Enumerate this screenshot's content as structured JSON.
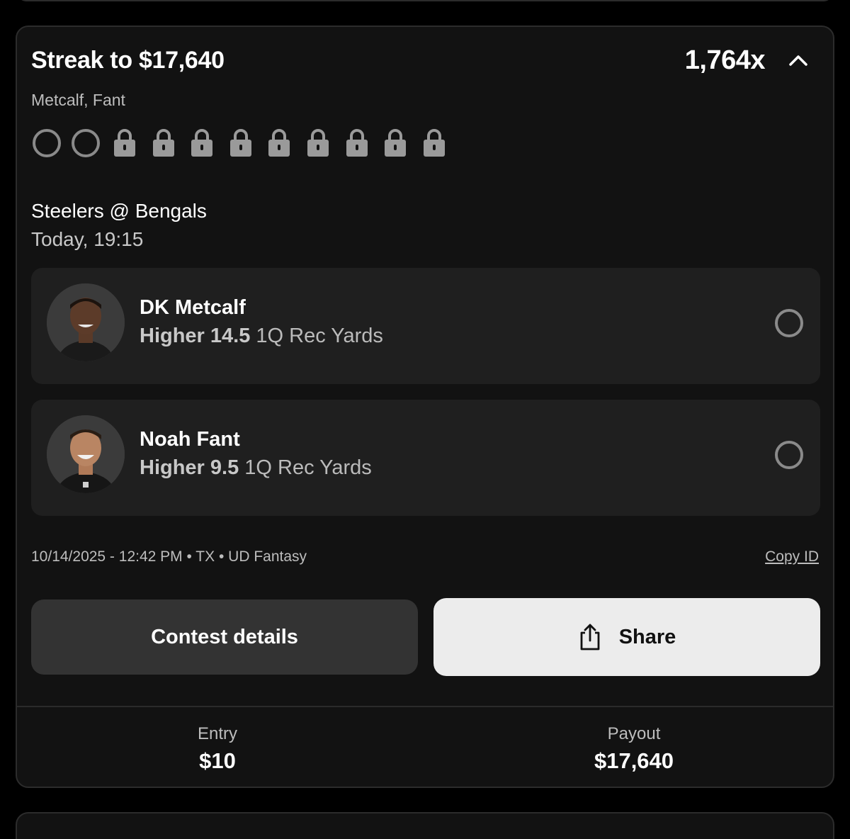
{
  "card": {
    "title": "Streak to $17,640",
    "multiplier": "1,764x",
    "subtitle": "Metcalf, Fant",
    "progress": {
      "open_count": 2,
      "locked_count": 9
    },
    "game": {
      "matchup": "Steelers @ Bengals",
      "time": "Today, 19:15"
    },
    "picks": [
      {
        "player": "DK Metcalf",
        "direction": "Higher 14.5",
        "stat": "1Q Rec Yards"
      },
      {
        "player": "Noah Fant",
        "direction": "Higher 9.5",
        "stat": "1Q Rec Yards"
      }
    ],
    "meta": "10/14/2025 - 12:42 PM • TX • UD Fantasy",
    "copy_id": "Copy ID",
    "buttons": {
      "contest": "Contest details",
      "share": "Share"
    },
    "entry": {
      "label": "Entry",
      "value": "$10"
    },
    "payout": {
      "label": "Payout",
      "value": "$17,640"
    }
  },
  "icons": {
    "collapse": "chevron-up-icon",
    "open_leg": "ring-icon",
    "locked_leg": "lock-icon",
    "share": "share-icon"
  }
}
